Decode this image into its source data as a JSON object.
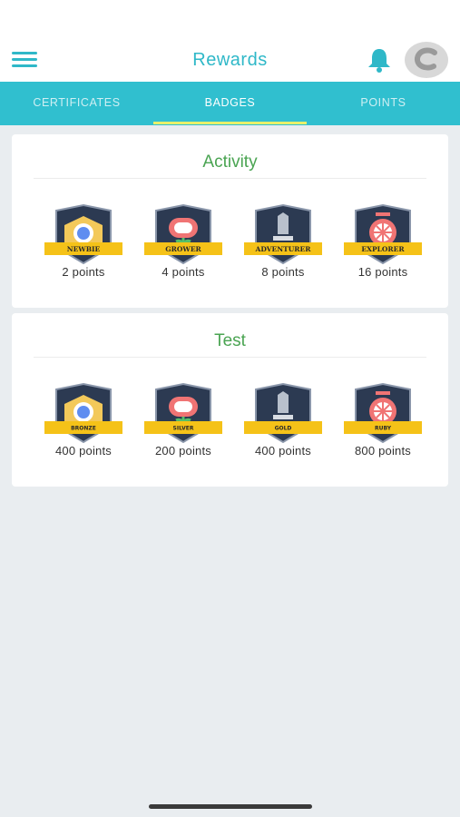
{
  "header": {
    "title": "Rewards",
    "icons": [
      "menu-icon",
      "bell-icon",
      "avatar"
    ]
  },
  "tabs": [
    {
      "label": "CERTIFICATES",
      "active": false
    },
    {
      "label": "BADGES",
      "active": true
    },
    {
      "label": "POINTS",
      "active": false
    }
  ],
  "sections": [
    {
      "title": "Activity",
      "badges": [
        {
          "ribbon": "NEWBIE",
          "points": "2 points",
          "icon": "gear-icon"
        },
        {
          "ribbon": "GROWER",
          "points": "4 points",
          "icon": "flower-icon"
        },
        {
          "ribbon": "ADVENTURER",
          "points": "8 points",
          "icon": "sword-icon"
        },
        {
          "ribbon": "EXPLORER",
          "points": "16 points",
          "icon": "ship-wheel-icon"
        }
      ]
    },
    {
      "title": "Test",
      "badges": [
        {
          "ribbon": "BRONZE",
          "points": "400 points",
          "icon": "gear-icon"
        },
        {
          "ribbon": "SILVER",
          "points": "200 points",
          "icon": "flower-icon"
        },
        {
          "ribbon": "GOLD",
          "points": "400 points",
          "icon": "sword-icon"
        },
        {
          "ribbon": "RUBY",
          "points": "800 points",
          "icon": "ship-wheel-icon"
        }
      ]
    }
  ],
  "colors": {
    "accent": "#30bfcf",
    "tab_indicator": "#e7f06b",
    "section_title": "#4aa452",
    "badge_shield": "#2c3a52",
    "ribbon": "#f5c218"
  }
}
